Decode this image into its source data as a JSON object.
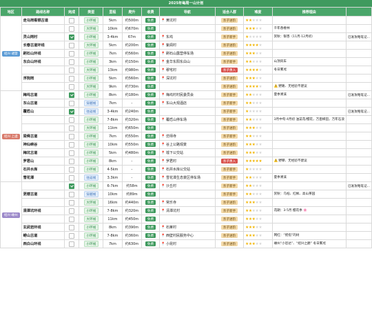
{
  "sheet_title": "2025年每周一山计划",
  "columns": [
    "地区",
    "路线名称",
    "完成",
    "类型",
    "里程",
    "爬升",
    "收费",
    "导航",
    "适合人群",
    "难度",
    "推荐理由"
  ],
  "colors": {
    "header_green": "#4aa66a",
    "title_green": "#3f9a5e",
    "region_blue": "#5b9bd5",
    "region_red": "#d97b6c",
    "region_purple": "#9b88c9",
    "star": "#f2b400"
  },
  "regions": [
    {
      "label": "绍兴·诸暨",
      "color": "#5b9bd5"
    },
    {
      "label": "绍兴·上虞",
      "color": "#d97b6c"
    },
    {
      "label": "绍兴·嵊州",
      "color": "#9b88c9"
    }
  ],
  "rows": [
    {
      "name": "走马岗看银古道",
      "done": false,
      "type": "小环线",
      "dist": "5km",
      "climb": "约500m",
      "fee": "免费",
      "nav": "黄坑村",
      "crowd": "亲子进阶",
      "stars": 2,
      "reason": "",
      "note": ""
    },
    {
      "name": "",
      "done": false,
      "type": "大环线",
      "dist": "10km",
      "climb": "约670m",
      "fee": "免费",
      "nav": "",
      "crowd": "亲子进阶",
      "stars": 3,
      "reason": "千年香榧林",
      "note": ""
    },
    {
      "name": "灵山岗村",
      "done": true,
      "type": "小环线",
      "dist": "3-4km",
      "climb": "67m",
      "fee": "免费",
      "nav": "东坞",
      "crowd": "亲子新手",
      "stars": 1,
      "reason": "赏秋：银杏（11月-12月初）",
      "note": "已发攻略笔记..."
    },
    {
      "name": "长春古道环线",
      "done": false,
      "type": "大环线",
      "dist": "5km",
      "climb": "约200m",
      "fee": "免费",
      "nav": "紫阆村",
      "crowd": "亲子进阶",
      "stars": 4,
      "reason": "",
      "note": ""
    },
    {
      "name": "刷石山环线",
      "done": false,
      "type": "小环线",
      "dist": "7km",
      "climb": "约560m",
      "fee": "免费",
      "nav": "刷石山露营停车场",
      "crowd": "亲子进阶",
      "stars": 3,
      "reason": "",
      "note": ""
    },
    {
      "name": "东白山环线",
      "done": false,
      "type": "小环线",
      "dist": "3km",
      "climb": "约150m",
      "fee": "免费",
      "nav": "金华东阳东白山",
      "crowd": "亲子新手",
      "stars": 2,
      "reason": "山顶风车",
      "note": ""
    },
    {
      "name": "",
      "done": false,
      "type": "大环线",
      "dist": "13km",
      "climb": "约980m",
      "fee": "免费",
      "nav": "穆宅村",
      "crowd": "亲子勇入",
      "stars": 4,
      "reason": "冬日雾凇",
      "note": ""
    },
    {
      "name": "浮狗岗",
      "done": false,
      "type": "小环线",
      "dist": "5km",
      "climb": "约560m",
      "fee": "免费",
      "nav": "深坑村",
      "crowd": "亲子进阶",
      "stars": 3,
      "reason": "",
      "note": ""
    },
    {
      "name": "",
      "done": false,
      "type": "大环线",
      "dist": "9km",
      "climb": "约730m",
      "fee": "免费",
      "nav": "",
      "crowd": "亲子进阶",
      "stars": 4,
      "reason": "野路、无经验不建议",
      "note": "",
      "warn": true
    },
    {
      "name": "梅坞古道",
      "done": true,
      "type": "小环线",
      "dist": "8km",
      "climb": "约180m",
      "fee": "免费",
      "nav": "梅坞村村民委员会",
      "crowd": "亲子新手",
      "stars": 2,
      "reason": "夏季溯溪",
      "note": "已发攻略笔记..."
    },
    {
      "name": "东山古道",
      "done": false,
      "type": "穿越线",
      "dist": "7km",
      "climb": "-",
      "fee": "免费",
      "nav": "东山大观酒店",
      "crowd": "亲子新手",
      "stars": 2,
      "reason": "",
      "note": ""
    },
    {
      "name": "覆卮山",
      "done": true,
      "type": "往返线",
      "dist": "3-4km",
      "climb": "约240m",
      "fee": "免费",
      "nav": "",
      "crowd": "亲子新手",
      "stars": 1,
      "reason": "",
      "note": "已发攻略笔记..."
    },
    {
      "name": "",
      "done": false,
      "type": "小环线",
      "dist": "7-8km",
      "climb": "约320m",
      "fee": "免费",
      "nav": "覆卮山停车场",
      "crowd": "亲子新手",
      "stars": 2,
      "reason": "3月中旬-4月初 油菜花/樱花，万亩梯田，万年石浪",
      "note": ""
    },
    {
      "name": "",
      "done": false,
      "type": "大环线",
      "dist": "11km",
      "climb": "约650m",
      "fee": "免费",
      "nav": "",
      "crowd": "亲子进阶",
      "stars": 3,
      "reason": "",
      "note": ""
    },
    {
      "name": "梁舜古道",
      "done": false,
      "type": "小环线",
      "dist": "7km",
      "climb": "约550m",
      "fee": "免费",
      "nav": "仿师寺",
      "crowd": "亲子新手",
      "stars": 2,
      "reason": "",
      "note": ""
    },
    {
      "name": "神仙峡谷",
      "done": false,
      "type": "小环线",
      "dist": "10km",
      "climb": "约550m",
      "fee": "免费",
      "nav": "谷上公路观景",
      "crowd": "亲子进阶",
      "stars": 3,
      "reason": "",
      "note": ""
    },
    {
      "name": "梅坑古道",
      "done": false,
      "type": "小环线",
      "dist": "5km",
      "climb": "约480m",
      "fee": "免费",
      "nav": "墟下公交站",
      "crowd": "亲子进阶",
      "stars": 3,
      "reason": "",
      "note": ""
    },
    {
      "name": "罗君山",
      "done": false,
      "type": "小环线",
      "dist": "8km",
      "climb": "-",
      "fee": "免费",
      "nav": "罗君村",
      "crowd": "亲子勇入",
      "stars": 5,
      "reason": "野攀、无经验不建议",
      "note": "",
      "warn": true
    },
    {
      "name": "石井水库",
      "done": false,
      "type": "小环线",
      "dist": "4-5km",
      "climb": "-",
      "fee": "免费",
      "nav": "石井水库公交站",
      "crowd": "亲子新手",
      "stars": 1,
      "reason": "",
      "note": ""
    },
    {
      "name": "雪花潭",
      "done": false,
      "type": "往返线",
      "dist": "3.3km",
      "climb": "-",
      "fee": "免费",
      "nav": "雪花潭生态景区停车场",
      "crowd": "亲子新手",
      "stars": 2,
      "reason": "夏季溯溪",
      "note": ""
    },
    {
      "name": "",
      "done": true,
      "type": "小环线",
      "dist": "6-7km",
      "climb": "约58m",
      "fee": "免费",
      "nav": "沙丘村",
      "crowd": "亲子新手",
      "stars": 2,
      "reason": "",
      "note": "已发攻略笔记..."
    },
    {
      "name": "更楼古道",
      "done": false,
      "type": "穿越线",
      "dist": "10km",
      "climb": "约89m",
      "fee": "免费",
      "nav": "",
      "crowd": "亲子新手",
      "stars": 2,
      "reason": "赏秋：乌桕、红枫、高山茶园",
      "note": ""
    },
    {
      "name": "",
      "done": false,
      "type": "大环线",
      "dist": "16km",
      "climb": "约440m",
      "fee": "免费",
      "nav": "常乐寺",
      "crowd": "亲子进阶",
      "stars": 3,
      "reason": "",
      "note": ""
    },
    {
      "name": "清潭坑环线",
      "done": false,
      "type": "小环线",
      "dist": "7-8km",
      "climb": "约320m",
      "fee": "免费",
      "nav": "清潭坑村",
      "crowd": "亲子新手",
      "stars": 2,
      "reason": "花期：3-5月 樱花季",
      "note": "",
      "flower": true
    },
    {
      "name": "",
      "done": false,
      "type": "大环线",
      "dist": "11km",
      "climb": "约450m",
      "fee": "免费",
      "nav": "",
      "crowd": "亲子进阶",
      "stars": 3,
      "reason": "",
      "note": ""
    },
    {
      "name": "玄武岩环线",
      "done": false,
      "type": "小环线",
      "dist": "8km",
      "climb": "约390m",
      "fee": "免费",
      "nav": "石莱村",
      "crowd": "亲子进阶",
      "stars": 3,
      "reason": "",
      "note": ""
    },
    {
      "name": "崂山古道",
      "done": false,
      "type": "小环线",
      "dist": "7-8km",
      "climb": "约360m",
      "fee": "免费",
      "nav": "西壁村民服务中心",
      "crowd": "亲子进阶",
      "stars": 3,
      "reason": "网红：“摇指”的树",
      "note": ""
    },
    {
      "name": "西白山环线",
      "done": false,
      "type": "小环线",
      "dist": "7km",
      "climb": "约630m",
      "fee": "免费",
      "nav": "小昆村",
      "crowd": "亲子进阶",
      "stars": 3,
      "reason": "嵊州“小恐达”、“绍兴之巅” 冬日雾凇",
      "note": ""
    }
  ]
}
